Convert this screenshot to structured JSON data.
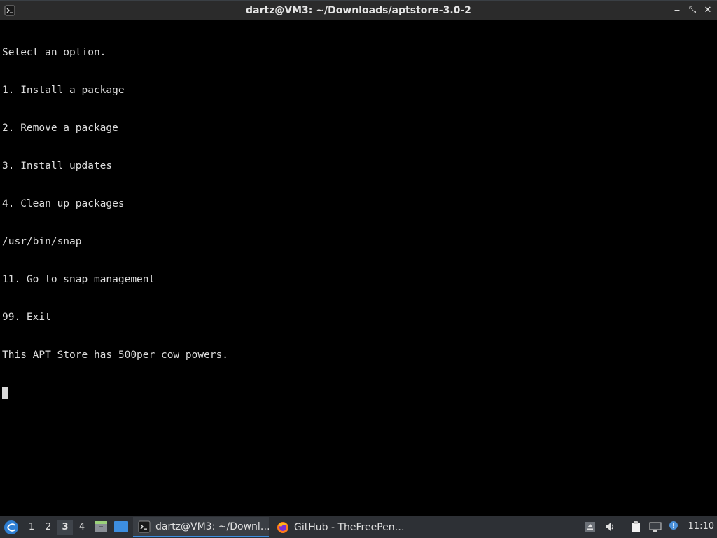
{
  "window": {
    "title": "dartz@VM3: ~/Downloads/aptstore-3.0-2",
    "controls": {
      "minimize_glyph": "‒",
      "maximize_glyph": "⤡",
      "close_glyph": "✕"
    }
  },
  "terminal": {
    "lines": [
      "Select an option.",
      "1. Install a package",
      "2. Remove a package",
      "3. Install updates",
      "4. Clean up packages",
      "/usr/bin/snap",
      "11. Go to snap management",
      "99. Exit",
      "This APT Store has 500per cow powers."
    ]
  },
  "taskbar": {
    "desktops": [
      "1",
      "2",
      "3",
      "4"
    ],
    "active_desktop": "3",
    "tasks": [
      {
        "label": "dartz@VM3: ~/Downl…",
        "icon": "terminal-icon"
      },
      {
        "label": "GitHub - TheFreePen…",
        "icon": "firefox-icon"
      }
    ],
    "clock": "11:10"
  },
  "colors": {
    "accent": "#3d8ee0",
    "terminal_bg": "#000000",
    "terminal_fg": "#dedede",
    "panel_bg": "#2d3035"
  }
}
